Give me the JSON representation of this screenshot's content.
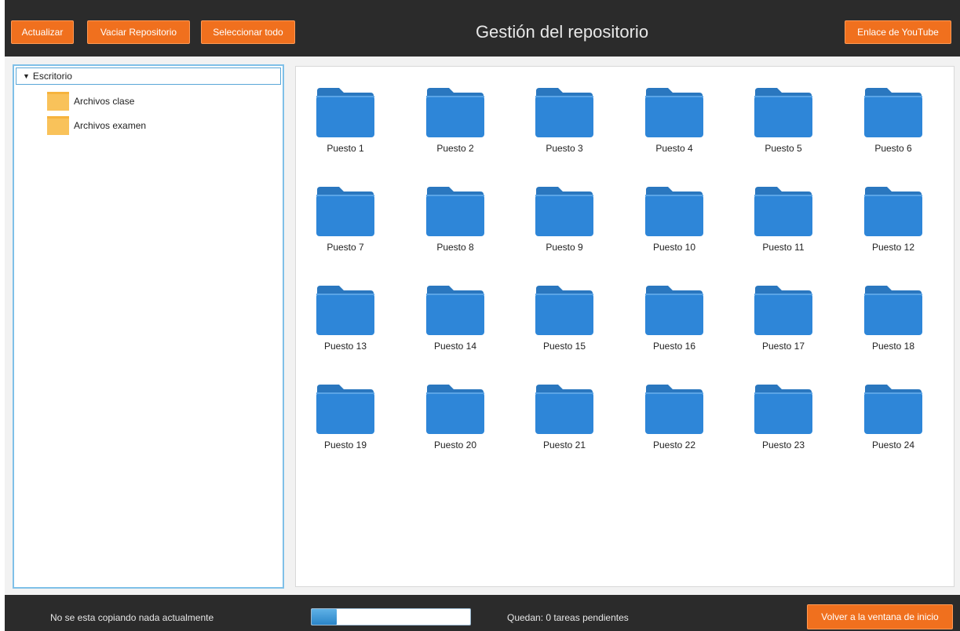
{
  "toolbar": {
    "refresh_label": "Actualizar",
    "empty_repo_label": "Vaciar Repositorio",
    "select_all_label": "Seleccionar todo",
    "title": "Gestión del repositorio",
    "youtube_label": "Enlace de YouTube"
  },
  "tree": {
    "root_label": "Escritorio",
    "items": [
      {
        "label": "Archivos clase",
        "icon": "folder-icon"
      },
      {
        "label": "Archivos examen",
        "icon": "folder-icon"
      }
    ]
  },
  "folders": [
    "Puesto 1",
    "Puesto 2",
    "Puesto 3",
    "Puesto 4",
    "Puesto 5",
    "Puesto 6",
    "Puesto 7",
    "Puesto 8",
    "Puesto 9",
    "Puesto 10",
    "Puesto 11",
    "Puesto 12",
    "Puesto 13",
    "Puesto 14",
    "Puesto 15",
    "Puesto 16",
    "Puesto 17",
    "Puesto 18",
    "Puesto 19",
    "Puesto 20",
    "Puesto 21",
    "Puesto 22",
    "Puesto 23",
    "Puesto 24"
  ],
  "status": {
    "copy_status": "No se esta copiando nada actualmente",
    "progress_fraction": 0.16,
    "pending_tasks": "Quedan: 0 tareas pendientes",
    "back_label": "Volver a la ventana de inicio"
  },
  "colors": {
    "accent": "#f0701e",
    "folder_blue": "#2e86d8",
    "tree_folder": "#f9c25a"
  }
}
